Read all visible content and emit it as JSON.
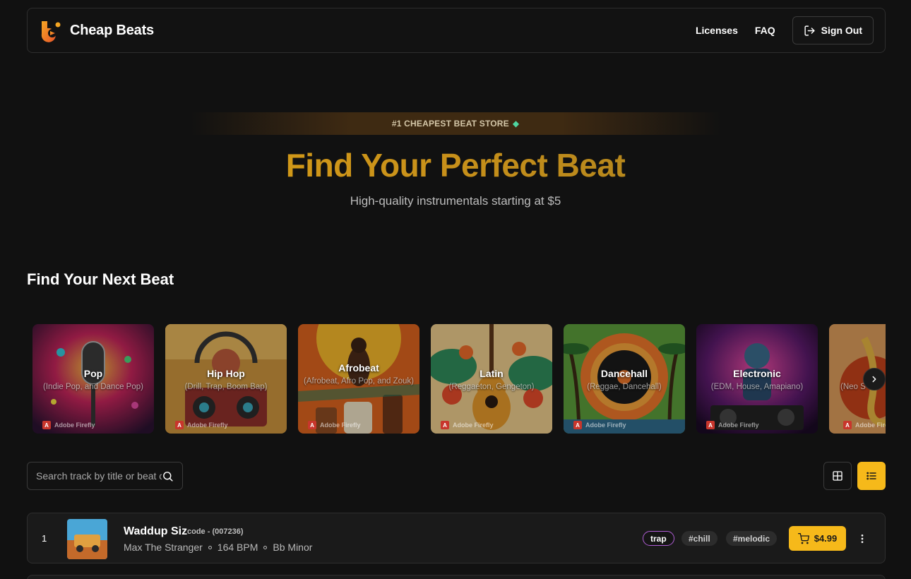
{
  "header": {
    "brand": "Cheap Beats",
    "nav": {
      "licenses": "Licenses",
      "faq": "FAQ"
    },
    "sign_out": "Sign Out"
  },
  "hero": {
    "badge": "#1 CHEAPEST BEAT STORE",
    "title": "Find Your Perfect Beat",
    "subtitle": "High-quality instrumentals starting at $5"
  },
  "genres_section": {
    "title": "Find Your Next Beat",
    "watermark": "Adobe Firefly",
    "items": [
      {
        "name": "Pop",
        "desc": "(Indie Pop, and Dance Pop)"
      },
      {
        "name": "Hip Hop",
        "desc": "(Drill, Trap, Boom Bap)"
      },
      {
        "name": "Afrobeat",
        "desc": "(Afrobeat, Afro Pop, and Zouk)"
      },
      {
        "name": "Latin",
        "desc": "(Reggaeton, Gengeton)"
      },
      {
        "name": "Dancehall",
        "desc": "(Reggae, Dancehall)"
      },
      {
        "name": "Electronic",
        "desc": "(EDM, House, Amapiano)"
      },
      {
        "name": "R",
        "desc": "(Neo S"
      }
    ]
  },
  "search": {
    "placeholder": "Search track by title or beat code"
  },
  "tracks": [
    {
      "index": "1",
      "title": "Waddup Siz",
      "code": "code - (007236)",
      "artist": "Max The Stranger",
      "bpm": "164 BPM",
      "key": "Bb Minor",
      "tags": [
        "trap",
        "#chill",
        "#melodic"
      ],
      "price": "$4.99"
    }
  ],
  "colors": {
    "accent": "#f6b91a",
    "background": "#111111",
    "title_gradient": [
      "#e0a516",
      "#9c7a20"
    ]
  }
}
